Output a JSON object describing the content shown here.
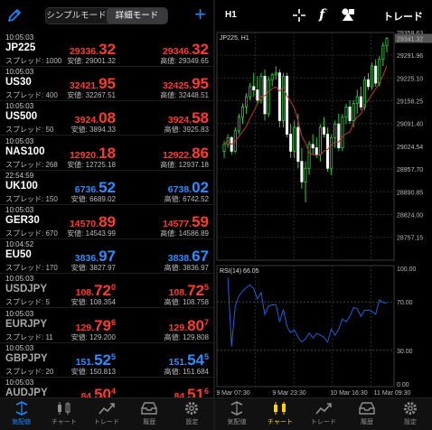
{
  "left": {
    "segment": {
      "simple": "シンプルモード",
      "detail": "詳細モード"
    },
    "quotes": [
      {
        "time": "10:05:03",
        "symbol": "JP225",
        "spread": "スプレッド: 1000",
        "bid_pre": "29336.",
        "bid_big": "32",
        "bid_sup": "",
        "ask_pre": "29346.",
        "ask_big": "32",
        "ask_sup": "",
        "low": "安値: 29001.32",
        "high": "高値: 29349.65",
        "color": "red",
        "dim": false
      },
      {
        "time": "10:05:03",
        "symbol": "US30",
        "spread": "スプレッド: 400",
        "bid_pre": "32421.",
        "bid_big": "95",
        "bid_sup": "",
        "ask_pre": "32425.",
        "ask_big": "95",
        "ask_sup": "",
        "low": "安値: 32267.51",
        "high": "高値: 32448.51",
        "color": "red",
        "dim": false
      },
      {
        "time": "10:05:03",
        "symbol": "US500",
        "spread": "スプレッド: 50",
        "bid_pre": "3924.",
        "bid_big": "08",
        "bid_sup": "",
        "ask_pre": "3924.",
        "ask_big": "58",
        "ask_sup": "",
        "low": "安値: 3894.33",
        "high": "高値: 3925.83",
        "color": "red",
        "dim": false
      },
      {
        "time": "10:05:03",
        "symbol": "NAS100",
        "spread": "スプレッド: 268",
        "bid_pre": "12920.",
        "bid_big": "18",
        "bid_sup": "",
        "ask_pre": "12922.",
        "ask_big": "86",
        "ask_sup": "",
        "low": "安値: 12725.18",
        "high": "高値: 12937.18",
        "color": "red",
        "dim": false
      },
      {
        "time": "22:54:59",
        "symbol": "UK100",
        "spread": "スプレッド: 150",
        "bid_pre": "6736.",
        "bid_big": "52",
        "bid_sup": "",
        "ask_pre": "6738.",
        "ask_big": "02",
        "ask_sup": "",
        "low": "安値: 6689.02",
        "high": "高値: 6742.52",
        "color": "blue",
        "dim": false
      },
      {
        "time": "10:05:03",
        "symbol": "GER30",
        "spread": "スプレッド: 670",
        "bid_pre": "14570.",
        "bid_big": "89",
        "bid_sup": "",
        "ask_pre": "14577.",
        "ask_big": "59",
        "ask_sup": "",
        "low": "安値: 14543.99",
        "high": "高値: 14586.89",
        "color": "red",
        "dim": false
      },
      {
        "time": "10:04:52",
        "symbol": "EU50",
        "spread": "スプレッド: 170",
        "bid_pre": "3836.",
        "bid_big": "97",
        "bid_sup": "",
        "ask_pre": "3838.",
        "ask_big": "67",
        "ask_sup": "",
        "low": "安値: 3827.97",
        "high": "高値: 3836.97",
        "color": "blue",
        "dim": false
      },
      {
        "time": "10:05:03",
        "symbol": "USDJPY",
        "spread": "スプレッド: 5",
        "bid_pre": "108.",
        "bid_big": "72",
        "bid_sup": "0",
        "ask_pre": "108.",
        "ask_big": "72",
        "ask_sup": "5",
        "low": "安値: 108.354",
        "high": "高値: 108.758",
        "color": "red",
        "dim": true
      },
      {
        "time": "10:05:03",
        "symbol": "EURJPY",
        "spread": "スプレッド: 11",
        "bid_pre": "129.",
        "bid_big": "79",
        "bid_sup": "6",
        "ask_pre": "129.",
        "ask_big": "80",
        "ask_sup": "7",
        "low": "安値: 129.200",
        "high": "高値: 129.808",
        "color": "red",
        "dim": true
      },
      {
        "time": "10:05:03",
        "symbol": "GBPJPY",
        "spread": "スプレッド: 20",
        "bid_pre": "151.",
        "bid_big": "52",
        "bid_sup": "5",
        "ask_pre": "151.",
        "ask_big": "54",
        "ask_sup": "5",
        "low": "安値: 150.813",
        "high": "高値: 151.684",
        "color": "blue",
        "dim": true
      },
      {
        "time": "10:05:03",
        "symbol": "AUDJPY",
        "spread": "",
        "bid_pre": "84.",
        "bid_big": "50",
        "bid_sup": "4",
        "ask_pre": "84.",
        "ask_big": "51",
        "ask_sup": "6",
        "low": "",
        "high": "",
        "color": "red",
        "dim": true
      }
    ],
    "tabs": [
      "気配値",
      "チャート",
      "トレード",
      "履歴",
      "設定"
    ]
  },
  "right": {
    "timeframe": "H1",
    "trade_label": "トレード",
    "chart_title": "JP225, H1",
    "rsi_label": "RSI(14) 66.05",
    "tabs": [
      "気配値",
      "チャート",
      "トレード",
      "履歴",
      "設定"
    ]
  },
  "chart_data": {
    "type": "candlestick",
    "symbol": "JP225",
    "timeframe": "H1",
    "price_ticks": [
      "29358.63",
      "29341.32",
      "29291.96",
      "29225.10",
      "29158.25",
      "29091.40",
      "29024.54",
      "28957.70",
      "28890.85",
      "28824.00",
      "28757.15"
    ],
    "current_price": "29341.32",
    "ylim": [
      28690,
      29358.63
    ],
    "x_labels": [
      "9 Mar 07:30",
      "9 Mar 23:30",
      "10 Mar 16:30",
      "11 Mar 09:30"
    ],
    "rsi": {
      "period": 14,
      "value": 66.05,
      "ticks": [
        "100.00",
        "70.00",
        "30.00",
        "0.00"
      ]
    },
    "candles": [
      [
        29010,
        29040,
        28990,
        29030
      ],
      [
        29030,
        29060,
        29020,
        29050
      ],
      [
        29050,
        29055,
        29000,
        29010
      ],
      [
        29010,
        29080,
        29005,
        29070
      ],
      [
        29070,
        29120,
        29060,
        29110
      ],
      [
        29110,
        29150,
        29090,
        29140
      ],
      [
        29140,
        29180,
        29120,
        29170
      ],
      [
        29170,
        29210,
        29160,
        29200
      ],
      [
        29200,
        29240,
        29170,
        29190
      ],
      [
        29190,
        29230,
        29150,
        29160
      ],
      [
        29160,
        29240,
        29150,
        29230
      ],
      [
        29230,
        29250,
        29100,
        29120
      ],
      [
        29120,
        29230,
        29110,
        29220
      ],
      [
        29220,
        29240,
        29200,
        29235
      ],
      [
        29235,
        29260,
        29220,
        29240
      ],
      [
        29240,
        29250,
        29080,
        29100
      ],
      [
        29100,
        29240,
        29080,
        29230
      ],
      [
        29230,
        29240,
        29050,
        29060
      ],
      [
        29060,
        29090,
        28990,
        29010
      ],
      [
        29010,
        29100,
        28990,
        29080
      ],
      [
        29080,
        29120,
        28960,
        28980
      ],
      [
        28980,
        29020,
        28900,
        28920
      ],
      [
        28920,
        28980,
        28860,
        28960
      ],
      [
        28960,
        29040,
        28940,
        29030
      ],
      [
        29030,
        29060,
        29000,
        29020
      ],
      [
        29020,
        29050,
        28990,
        29000
      ],
      [
        29000,
        29090,
        28980,
        29080
      ],
      [
        29080,
        29110,
        29050,
        29060
      ],
      [
        29060,
        29080,
        28950,
        28960
      ],
      [
        28960,
        29060,
        28940,
        29050
      ],
      [
        29050,
        29100,
        29020,
        29090
      ],
      [
        29090,
        29120,
        29010,
        29020
      ],
      [
        29020,
        29120,
        29010,
        29110
      ],
      [
        29110,
        29150,
        29090,
        29140
      ],
      [
        29140,
        29160,
        29090,
        29100
      ],
      [
        29100,
        29160,
        29080,
        29150
      ],
      [
        29150,
        29190,
        29120,
        29170
      ],
      [
        29170,
        29200,
        29130,
        29140
      ],
      [
        29140,
        29230,
        29130,
        29220
      ],
      [
        29220,
        29240,
        29190,
        29200
      ],
      [
        29200,
        29270,
        29190,
        29260
      ],
      [
        29260,
        29280,
        29200,
        29210
      ],
      [
        29210,
        29290,
        29200,
        29280
      ],
      [
        29280,
        29330,
        29260,
        29320
      ],
      [
        29320,
        29345,
        29300,
        29341
      ]
    ]
  }
}
